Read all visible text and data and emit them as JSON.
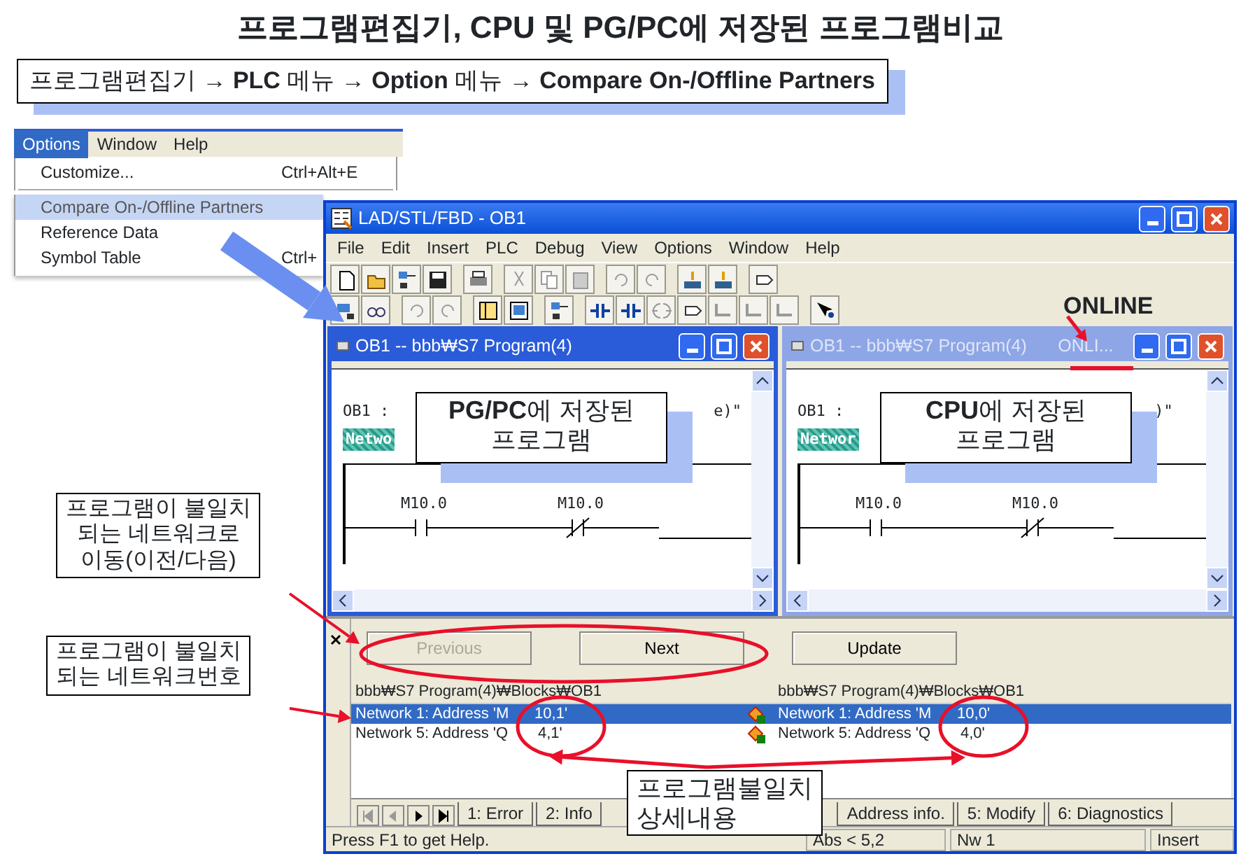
{
  "title": "프로그램편집기, CPU 및 PG/PC에 저장된 프로그램비교",
  "path_caption": "프로그램편집기 → **PLC** 메뉴 → **Option** 메뉴 → **Compare On-/Offline Partners**",
  "menu_snippet": {
    "menubar": [
      {
        "label": "Options",
        "selected": true
      },
      {
        "label": "Window",
        "selected": false
      },
      {
        "label": "Help",
        "selected": false
      }
    ],
    "items": [
      {
        "label": "Customize...",
        "shortcut": "Ctrl+Alt+E",
        "selected": false,
        "separator_after": true
      },
      {
        "label": "Compare On-/Offline Partners",
        "selected": true,
        "separator_after": false
      },
      {
        "label": "Reference Data",
        "selected": false,
        "separator_after": false
      },
      {
        "label": "Symbol Table",
        "shortcut": "Ctrl+",
        "selected": false,
        "separator_after": false
      }
    ]
  },
  "window": {
    "title": "LAD/STL/FBD  - OB1",
    "menu": [
      "File",
      "Edit",
      "Insert",
      "PLC",
      "Debug",
      "View",
      "Options",
      "Window",
      "Help"
    ],
    "child_windows": [
      {
        "title": "OB1 -- bbb₩S7 Program(4)",
        "active": true,
        "header": "OB1 :",
        "header_tail": "e)\"",
        "network": "Netwo",
        "contacts": [
          {
            "address": "M10.0",
            "kind": "no"
          },
          {
            "address": "M10.0",
            "kind": "nc"
          }
        ]
      },
      {
        "title": "OB1 -- bbb₩S7 Program(4)",
        "status": "ONLI...",
        "active": false,
        "header": "OB1 :",
        "header_tail": ")\"",
        "network": "Networ",
        "contacts": [
          {
            "address": "M10.0",
            "kind": "no"
          },
          {
            "address": "M10.0",
            "kind": "nc"
          }
        ]
      }
    ],
    "compare": {
      "buttons": [
        {
          "label": "Previous",
          "disabled": true
        },
        {
          "label": "Next",
          "disabled": false
        },
        {
          "label": "Update",
          "disabled": false
        }
      ],
      "columns": [
        "bbb₩S7 Program(4)₩Blocks₩OB1",
        "bbb₩S7 Program(4)₩Blocks₩OB1"
      ],
      "rows": [
        {
          "left": "Network 1: Address 'M      10,1'",
          "right": "Network 1: Address 'M      10,0'",
          "selected": true
        },
        {
          "left": "Network 5: Address 'Q       4,1'",
          "right": "Network 5: Address 'Q       4,0'",
          "selected": false
        }
      ],
      "tabs": [
        "1: Error",
        "2: Info",
        "Address info.",
        "5: Modify",
        "6: Diagnostics"
      ]
    },
    "status_bar": [
      "Press F1 to get Help.",
      "Abs < 5,2",
      "Nw 1",
      "Insert"
    ]
  },
  "annotations": {
    "online_label": "ONLINE",
    "callouts": [
      {
        "kind": "window",
        "text": "**PG/PC**에 저장된\n프로그램"
      },
      {
        "kind": "window",
        "text": "**CPU**에 저장된\n프로그램"
      },
      {
        "kind": "side",
        "text": "프로그램이 불일치\n되는 네트워크로\n이동(이전/다음)"
      },
      {
        "kind": "side",
        "text": "프로그램이 불일치\n되는 네트워크번호"
      },
      {
        "kind": "side",
        "text": "프로그램불일치\n상세내용"
      }
    ]
  }
}
